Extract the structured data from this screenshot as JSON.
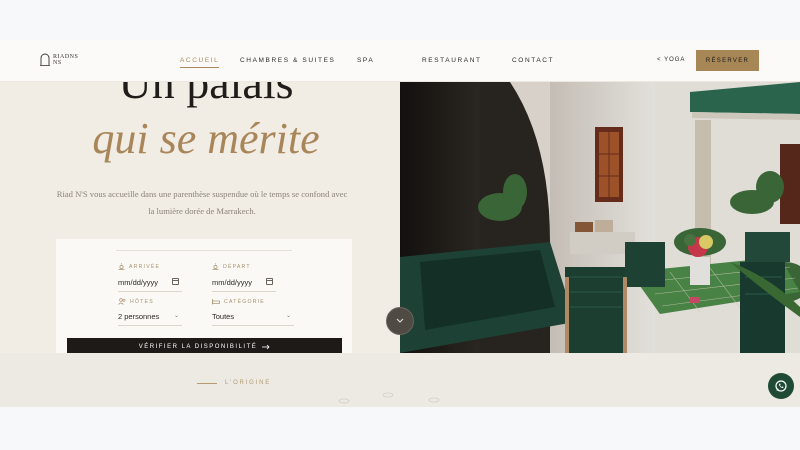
{
  "header": {
    "logo": {
      "line1": "RIADNS",
      "line2": "NS"
    },
    "nav": [
      "ACCUEIL",
      "CHAMBRES & SUITES",
      "SPA",
      "RESTAURANT",
      "CONTACT"
    ],
    "lang_link": "< YOGA",
    "reserve_label": "RÉSERVER"
  },
  "hero": {
    "title_line1": "Un palais",
    "title_line2": "qui se mérite",
    "subtitle": "Riad N'S vous accueille dans une parenthèse suspendue où le temps se confond avec la lumière dorée de Marrakech."
  },
  "booking": {
    "arrival_label": "ARRIVÉE",
    "arrival_placeholder": "mm/dd/yyyy",
    "departure_label": "DÉPART",
    "departure_placeholder": "mm/dd/yyyy",
    "guests_label": "HÔTES",
    "guests_value": "2 personnes",
    "category_label": "CATÉGORIE",
    "category_value": "Toutes",
    "check_label": "VÉRIFIER LA DISPONIBILITÉ"
  },
  "origin": {
    "label": "L'ORIGINE"
  },
  "colors": {
    "accent": "#a88756",
    "dark": "#1d1a17",
    "beige": "#f1ece4",
    "whatsapp": "#1e4a36"
  },
  "icons": [
    "logo-arch-icon",
    "sun-icon",
    "user-group-icon",
    "bed-icon",
    "calendar-icon",
    "chevron-down-icon",
    "arrow-right-icon",
    "whatsapp-icon"
  ]
}
